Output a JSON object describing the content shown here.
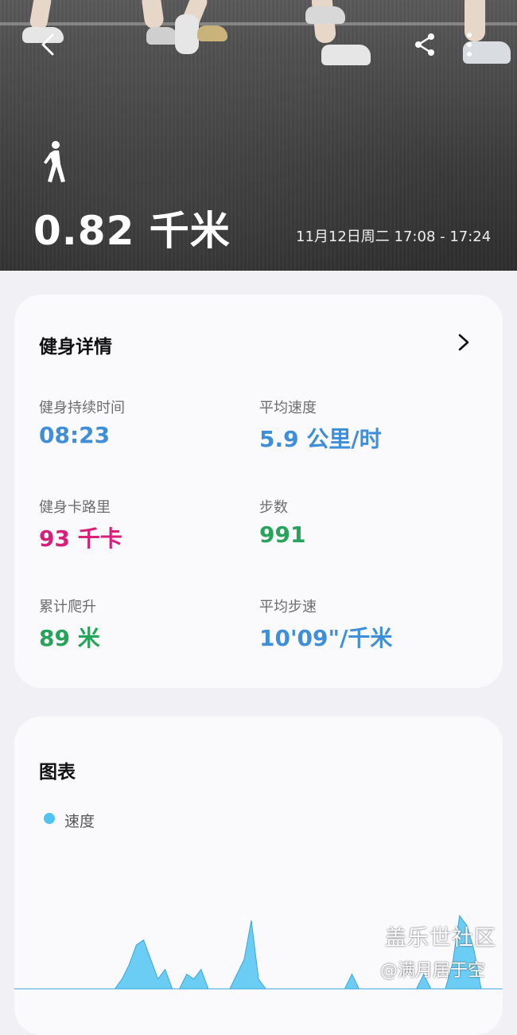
{
  "hero": {
    "distance": "0.82 千米",
    "date_range": "11月12日周二 17:08 - 17:24"
  },
  "details": {
    "title": "健身详情",
    "stats": [
      {
        "label": "健身持续时间",
        "value": "08:23",
        "color": "#3f8fd8"
      },
      {
        "label": "平均速度",
        "value": "5.9 公里/时",
        "color": "#3f8fd8"
      },
      {
        "label": "健身卡路里",
        "value": "93 千卡",
        "color": "#d8207a"
      },
      {
        "label": "步数",
        "value": "991",
        "color": "#25a45a"
      },
      {
        "label": "累计爬升",
        "value": "89 米",
        "color": "#25a45a"
      },
      {
        "label": "平均步速",
        "value": "10'09\"/千米",
        "color": "#3f8fd8"
      }
    ]
  },
  "chart_card": {
    "title": "图表",
    "legend": "速度"
  },
  "chart_data": {
    "type": "area",
    "series": [
      {
        "name": "速度",
        "values": [
          0,
          0,
          0,
          0,
          0,
          0,
          0,
          0,
          0,
          0,
          0,
          0,
          0,
          0,
          0,
          0.2,
          0.5,
          0.9,
          1.0,
          0.6,
          0.2,
          0.4,
          0.0,
          0.0,
          0.3,
          0.2,
          0.4,
          0.0,
          0.0,
          0.0,
          0.0,
          0.3,
          0.6,
          1.4,
          0.2,
          0.0,
          0.0,
          0.0,
          0.0,
          0.0,
          0.0,
          0.0,
          0.0,
          0.0,
          0.0,
          0.0,
          0.0,
          0.3,
          0.0,
          0.0,
          0.0,
          0.0,
          0.0,
          0.0,
          0.0,
          0.0,
          0.0,
          0.3,
          0.0,
          0.0,
          0.0,
          0.5,
          1.5,
          1.3,
          0.8,
          0.0,
          0.0,
          0.0,
          0.0
        ]
      }
    ],
    "color": "#52c4f2"
  },
  "watermark": {
    "line1": "盖乐世社区",
    "line2": "@满月居于空"
  },
  "icons": {
    "back": "back-arrow-icon",
    "share": "share-icon",
    "more": "more-vertical-icon",
    "walk": "walking-person-icon",
    "chevron": "chevron-right-icon"
  }
}
